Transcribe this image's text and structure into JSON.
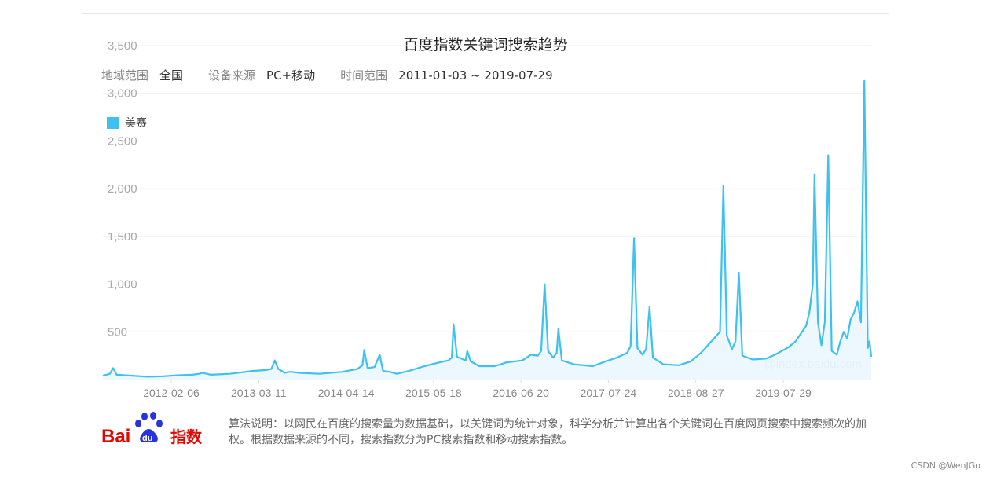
{
  "credit": "CSDN @WenJGo",
  "meta": {
    "region_label": "地域范围",
    "region_value": "全国",
    "device_label": "设备来源",
    "device_value": "PC+移动",
    "time_label": "时间范围",
    "time_value": "2011-01-03 ~ 2019-07-29"
  },
  "watermark": "@index.baidu.com",
  "logo": {
    "text_bai": "Bai",
    "text_du": "du",
    "text_index": "指数"
  },
  "note": "算法说明：以网民在百度的搜索量为数据基础，以关键词为统计对象，科学分析并计算出各个关键词在百度网页搜索中搜索频次的加权。根据数据来源的不同，搜索指数分为PC搜索指数和移动搜索指数。",
  "colors": {
    "line": "#3ec1ee",
    "fill": "#e9f7fd",
    "grid": "#eeeeee",
    "axis_text": "#aaaaaa"
  },
  "chart_data": {
    "type": "area",
    "title": "百度指数关键词搜索趋势",
    "legend": [
      "美赛"
    ],
    "legend_position": "top-left",
    "grid": true,
    "y_ticks": [
      500,
      1000,
      1500,
      2000,
      2500,
      3000,
      3500
    ],
    "y_tick_labels": [
      "500",
      "1,000",
      "1,500",
      "2,000",
      "2,500",
      "3,000",
      "3,500"
    ],
    "ylim": [
      0,
      3500
    ],
    "x_tick_labels": [
      "2012-02-06",
      "2013-03-11",
      "2014-04-14",
      "2015-05-18",
      "2016-06-20",
      "2017-07-24",
      "2018-08-27",
      "2019-07-29"
    ],
    "xlim": [
      "2011-01-03",
      "2019-07-29"
    ],
    "series": [
      {
        "name": "美赛",
        "points": [
          [
            "2011-01-03",
            40
          ],
          [
            "2011-01-31",
            60
          ],
          [
            "2011-02-14",
            120
          ],
          [
            "2011-02-28",
            50
          ],
          [
            "2011-05-02",
            40
          ],
          [
            "2011-07-04",
            30
          ],
          [
            "2011-09-05",
            35
          ],
          [
            "2011-11-07",
            45
          ],
          [
            "2012-01-02",
            50
          ],
          [
            "2012-01-30",
            60
          ],
          [
            "2012-02-13",
            70
          ],
          [
            "2012-03-19",
            50
          ],
          [
            "2012-06-04",
            60
          ],
          [
            "2012-09-03",
            90
          ],
          [
            "2012-10-29",
            100
          ],
          [
            "2012-11-19",
            110
          ],
          [
            "2012-12-03",
            200
          ],
          [
            "2012-12-17",
            110
          ],
          [
            "2013-01-14",
            70
          ],
          [
            "2013-01-28",
            80
          ],
          [
            "2013-02-11",
            80
          ],
          [
            "2013-03-11",
            70
          ],
          [
            "2013-06-03",
            60
          ],
          [
            "2013-09-02",
            80
          ],
          [
            "2013-11-04",
            110
          ],
          [
            "2013-11-25",
            150
          ],
          [
            "2013-12-02",
            310
          ],
          [
            "2013-12-16",
            120
          ],
          [
            "2014-01-13",
            130
          ],
          [
            "2014-02-03",
            260
          ],
          [
            "2014-02-17",
            90
          ],
          [
            "2014-03-17",
            80
          ],
          [
            "2014-04-14",
            60
          ],
          [
            "2014-06-02",
            90
          ],
          [
            "2014-08-04",
            140
          ],
          [
            "2014-10-06",
            180
          ],
          [
            "2014-11-10",
            200
          ],
          [
            "2014-11-24",
            230
          ],
          [
            "2014-12-01",
            580
          ],
          [
            "2014-12-15",
            240
          ],
          [
            "2015-01-19",
            200
          ],
          [
            "2015-01-26",
            300
          ],
          [
            "2015-02-09",
            190
          ],
          [
            "2015-03-16",
            140
          ],
          [
            "2015-05-18",
            140
          ],
          [
            "2015-07-06",
            180
          ],
          [
            "2015-09-07",
            200
          ],
          [
            "2015-10-12",
            260
          ],
          [
            "2015-11-09",
            250
          ],
          [
            "2015-11-23",
            300
          ],
          [
            "2015-12-07",
            1000
          ],
          [
            "2015-12-21",
            300
          ],
          [
            "2016-01-11",
            230
          ],
          [
            "2016-01-25",
            280
          ],
          [
            "2016-02-01",
            530
          ],
          [
            "2016-02-15",
            200
          ],
          [
            "2016-04-04",
            160
          ],
          [
            "2016-06-20",
            140
          ],
          [
            "2016-08-01",
            180
          ],
          [
            "2016-09-26",
            230
          ],
          [
            "2016-11-07",
            280
          ],
          [
            "2016-11-21",
            350
          ],
          [
            "2016-12-05",
            1480
          ],
          [
            "2016-12-19",
            330
          ],
          [
            "2017-01-09",
            260
          ],
          [
            "2017-01-23",
            320
          ],
          [
            "2017-02-06",
            760
          ],
          [
            "2017-02-20",
            230
          ],
          [
            "2017-04-03",
            160
          ],
          [
            "2017-06-05",
            150
          ],
          [
            "2017-07-24",
            190
          ],
          [
            "2017-09-04",
            280
          ],
          [
            "2017-10-09",
            380
          ],
          [
            "2017-11-06",
            460
          ],
          [
            "2017-11-20",
            500
          ],
          [
            "2017-12-04",
            2030
          ],
          [
            "2017-12-18",
            460
          ],
          [
            "2018-01-08",
            320
          ],
          [
            "2018-01-22",
            400
          ],
          [
            "2018-02-05",
            1120
          ],
          [
            "2018-02-19",
            250
          ],
          [
            "2018-04-02",
            210
          ],
          [
            "2018-05-28",
            220
          ],
          [
            "2018-07-02",
            260
          ],
          [
            "2018-08-27",
            340
          ],
          [
            "2018-09-24",
            400
          ],
          [
            "2018-10-15",
            480
          ],
          [
            "2018-11-05",
            560
          ],
          [
            "2018-11-19",
            700
          ],
          [
            "2018-12-03",
            1000
          ],
          [
            "2018-12-10",
            2150
          ],
          [
            "2018-12-24",
            600
          ],
          [
            "2019-01-07",
            360
          ],
          [
            "2019-01-21",
            600
          ],
          [
            "2019-02-04",
            2350
          ],
          [
            "2019-02-18",
            300
          ],
          [
            "2019-03-11",
            260
          ],
          [
            "2019-03-25",
            400
          ],
          [
            "2019-04-08",
            500
          ],
          [
            "2019-04-22",
            430
          ],
          [
            "2019-05-06",
            630
          ],
          [
            "2019-05-20",
            700
          ],
          [
            "2019-06-03",
            820
          ],
          [
            "2019-06-17",
            600
          ],
          [
            "2019-07-01",
            3130
          ],
          [
            "2019-07-15",
            330
          ],
          [
            "2019-07-22",
            400
          ],
          [
            "2019-07-29",
            240
          ]
        ]
      }
    ]
  }
}
